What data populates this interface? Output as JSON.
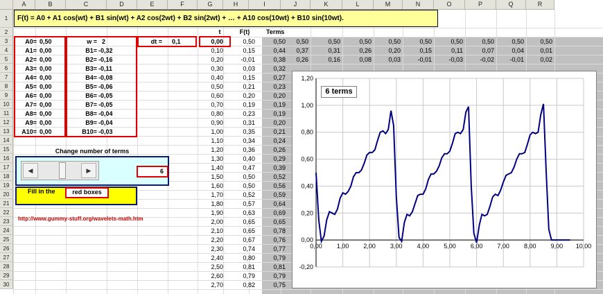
{
  "columns": [
    "A",
    "B",
    "C",
    "D",
    "E",
    "F",
    "G",
    "H",
    "I",
    "J",
    "K",
    "L",
    "M",
    "N",
    "O",
    "P",
    "Q",
    "R"
  ],
  "rows": [
    "1",
    "2",
    "3",
    "4",
    "5",
    "6",
    "7",
    "8",
    "9",
    "10",
    "11",
    "12",
    "13",
    "14",
    "15",
    "16",
    "17",
    "18",
    "19",
    "20",
    "21",
    "22",
    "23",
    "24",
    "25",
    "26",
    "27",
    "28",
    "29",
    "30"
  ],
  "formula_title": "F(t) = A0 + A1 cos(wt) + B1 sin(wt) + A2 cos(2wt) + B2 sin(2wt) + … + A10 cos(10wt) + B10 sin(10wt).",
  "headers": {
    "t": "t",
    "ft": "F(t)",
    "terms": "Terms"
  },
  "coef_a": [
    {
      "label": "A0=",
      "value": "0,50"
    },
    {
      "label": "A1=",
      "value": "0,00"
    },
    {
      "label": "A2=",
      "value": "0,00"
    },
    {
      "label": "A3=",
      "value": "0,00"
    },
    {
      "label": "A4=",
      "value": "0,00"
    },
    {
      "label": "A5=",
      "value": "0,00"
    },
    {
      "label": "A6=",
      "value": "0,00"
    },
    {
      "label": "A7=",
      "value": "0,00"
    },
    {
      "label": "A8=",
      "value": "0,00"
    },
    {
      "label": "A9=",
      "value": "0,00"
    },
    {
      "label": "A10=",
      "value": "0,00"
    }
  ],
  "w": {
    "label": "w =",
    "value": "2"
  },
  "coef_b": [
    {
      "label": "B1=",
      "value": "-0,32"
    },
    {
      "label": "B2=",
      "value": "-0,16"
    },
    {
      "label": "B3=",
      "value": "-0,11"
    },
    {
      "label": "B4=",
      "value": "-0,08"
    },
    {
      "label": "B5=",
      "value": "-0,06"
    },
    {
      "label": "B6=",
      "value": "-0,05"
    },
    {
      "label": "B7=",
      "value": "-0,05"
    },
    {
      "label": "B8=",
      "value": "-0,04"
    },
    {
      "label": "B9=",
      "value": "-0,04"
    },
    {
      "label": "B10=",
      "value": "-0,03"
    }
  ],
  "dt": {
    "label": "dt =",
    "value": "0,1"
  },
  "t_values": [
    "0,00",
    "0,10",
    "0,20",
    "0,30",
    "0,40",
    "0,50",
    "0,60",
    "0,70",
    "0,80",
    "0,90",
    "1,00",
    "1,10",
    "1,20",
    "1,30",
    "1,40",
    "1,50",
    "1,60",
    "1,70",
    "1,80",
    "1,90",
    "2,00",
    "2,10",
    "2,20",
    "2,30",
    "2,40",
    "2,50",
    "2,60",
    "2,70"
  ],
  "ft_values": [
    "0,50",
    "0,15",
    "-0,01",
    "0,03",
    "0,15",
    "0,21",
    "0,20",
    "0,19",
    "0,23",
    "0,31",
    "0,35",
    "0,34",
    "0,36",
    "0,40",
    "0,47",
    "0,50",
    "0,50",
    "0,52",
    "0,57",
    "0,63",
    "0,65",
    "0,65",
    "0,67",
    "0,74",
    "0,80",
    "0,81",
    "0,79",
    "0,82"
  ],
  "terms_values": [
    "0,50",
    "0,44",
    "0,38",
    "0,32",
    "0,27",
    "0,23",
    "0,20",
    "0,19",
    "0,19",
    "0,20",
    "0,21",
    "0,24",
    "0,26",
    "0,29",
    "0,39",
    "0,52",
    "0,56",
    "0,59",
    "0,64",
    "0,69",
    "0,65",
    "0,78",
    "0,76",
    "0,77",
    "0,79",
    "0,81",
    "0,79",
    "0,75"
  ],
  "terms_grid": [
    [
      "0,50",
      "0,50",
      "0,50",
      "0,50",
      "0,50",
      "0,50",
      "0,50",
      "0,50",
      "0,50"
    ],
    [
      "0,37",
      "0,31",
      "0,26",
      "0,20",
      "0,15",
      "0,11",
      "0,07",
      "0,04",
      "0,01"
    ],
    [
      "0,26",
      "0,16",
      "0,08",
      "0,03",
      "-0,01",
      "-0,03",
      "-0,02",
      "-0,01",
      "0,02"
    ]
  ],
  "scroll_label": "Change number of terms",
  "terms_count": "6",
  "scroll_arrows": {
    "left": "◀",
    "right": "▶"
  },
  "fill_in": {
    "prefix": "Fill in the",
    "boxes": "red boxes"
  },
  "link": "http://www.gummy-stuff.org/wavelets-math.htm",
  "chart_data": {
    "type": "line",
    "legend": "6 terms",
    "xlim": [
      0,
      10
    ],
    "ylim": [
      -0.2,
      1.2
    ],
    "xticks": [
      "0,00",
      "1,00",
      "2,00",
      "3,00",
      "4,00",
      "5,00",
      "6,00",
      "7,00",
      "8,00",
      "9,00",
      "10,00"
    ],
    "yticks": [
      "-0,20",
      "0,00",
      "0,20",
      "0,40",
      "0,60",
      "0,80",
      "1,00",
      "1,20"
    ],
    "series_color": "#000080",
    "x": [
      0.0,
      0.1,
      0.2,
      0.3,
      0.4,
      0.5,
      0.6,
      0.7,
      0.8,
      0.9,
      1.0,
      1.1,
      1.2,
      1.3,
      1.4,
      1.5,
      1.6,
      1.7,
      1.8,
      1.9,
      2.0,
      2.1,
      2.2,
      2.3,
      2.4,
      2.5,
      2.6,
      2.7,
      2.8,
      2.9,
      3.0,
      3.1,
      3.2,
      3.3,
      3.4,
      3.5,
      3.6,
      3.7,
      3.8,
      3.9,
      4.0,
      4.1,
      4.2,
      4.3,
      4.4,
      4.5,
      4.6,
      4.7,
      4.8,
      4.9,
      5.0,
      5.1,
      5.2,
      5.3,
      5.4,
      5.5,
      5.6,
      5.7,
      5.8,
      5.9,
      6.0,
      6.1,
      6.2,
      6.3,
      6.4,
      6.5,
      6.6,
      6.7,
      6.8,
      6.9,
      7.0,
      7.1,
      7.2,
      7.3,
      7.4,
      7.5,
      7.6,
      7.7,
      7.8,
      7.9,
      8.0,
      8.1,
      8.2,
      8.3,
      8.4,
      8.5,
      8.6,
      8.7,
      8.8,
      8.9,
      9.0,
      9.1,
      9.2,
      9.3,
      9.4,
      9.5,
      9.6,
      9.7
    ],
    "y": [
      0.5,
      0.15,
      -0.01,
      0.03,
      0.15,
      0.21,
      0.2,
      0.19,
      0.23,
      0.31,
      0.35,
      0.34,
      0.36,
      0.4,
      0.47,
      0.5,
      0.5,
      0.52,
      0.57,
      0.63,
      0.65,
      0.65,
      0.67,
      0.74,
      0.8,
      0.81,
      0.79,
      0.82,
      0.96,
      0.85,
      0.32,
      0.02,
      -0.01,
      0.13,
      0.19,
      0.18,
      0.21,
      0.27,
      0.33,
      0.34,
      0.34,
      0.38,
      0.45,
      0.49,
      0.49,
      0.51,
      0.55,
      0.61,
      0.64,
      0.64,
      0.66,
      0.72,
      0.79,
      0.8,
      0.79,
      0.82,
      0.95,
      0.99,
      0.4,
      0.05,
      -0.02,
      0.11,
      0.19,
      0.18,
      0.19,
      0.25,
      0.32,
      0.34,
      0.33,
      0.37,
      0.43,
      0.48,
      0.49,
      0.5,
      0.54,
      0.6,
      0.64,
      0.64,
      0.65,
      0.71,
      0.78,
      0.8,
      0.79,
      0.8,
      0.93,
      1.01,
      0.51,
      0.08,
      0.0,
      0.0,
      0.0,
      0.0,
      0.0,
      0.0,
      0.0,
      0.0
    ]
  }
}
